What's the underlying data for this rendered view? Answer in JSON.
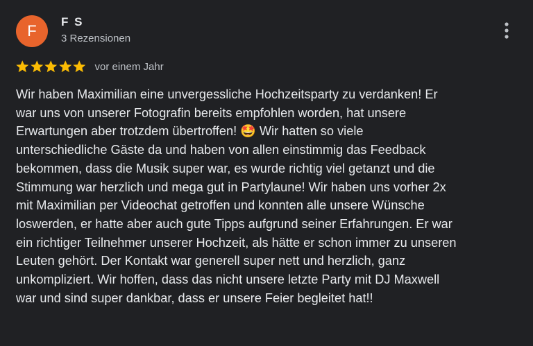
{
  "reviewer": {
    "initial": "F",
    "name": "F S",
    "review_count": "3 Rezensionen",
    "avatar_color": "#e8642c"
  },
  "rating": {
    "stars": 5,
    "max": 5,
    "star_color": "#fbbc04",
    "date": "vor einem Jahr"
  },
  "review": {
    "text": "Wir haben Maximilian eine unvergessliche Hochzeitsparty zu verdanken! Er\nwar uns von unserer Fotografin bereits empfohlen worden, hat unsere\nErwartungen aber trotzdem übertroffen! 🤩 Wir hatten so viele\nunterschiedliche Gäste da und haben von allen einstimmig das Feedback\nbekommen, dass die Musik super war, es wurde richtig viel getanzt und die\nStimmung war herzlich und mega gut in Partylaune! Wir haben uns vorher 2x\nmit Maximilian per Videochat getroffen und konnten alle unsere Wünsche\nloswerden, er hatte aber auch gute Tipps aufgrund seiner Erfahrungen. Er war\nein richtiger Teilnehmer unserer Hochzeit, als hätte er schon immer zu unseren\nLeuten gehört. Der Kontakt war generell super nett und herzlich, ganz\nunkompliziert. Wir hoffen, dass das nicht unsere letzte Party mit DJ Maxwell\nwar und sind super dankbar, dass er unsere Feier begleitet hat!!"
  },
  "menu": {
    "icon": "more-vert-icon"
  }
}
